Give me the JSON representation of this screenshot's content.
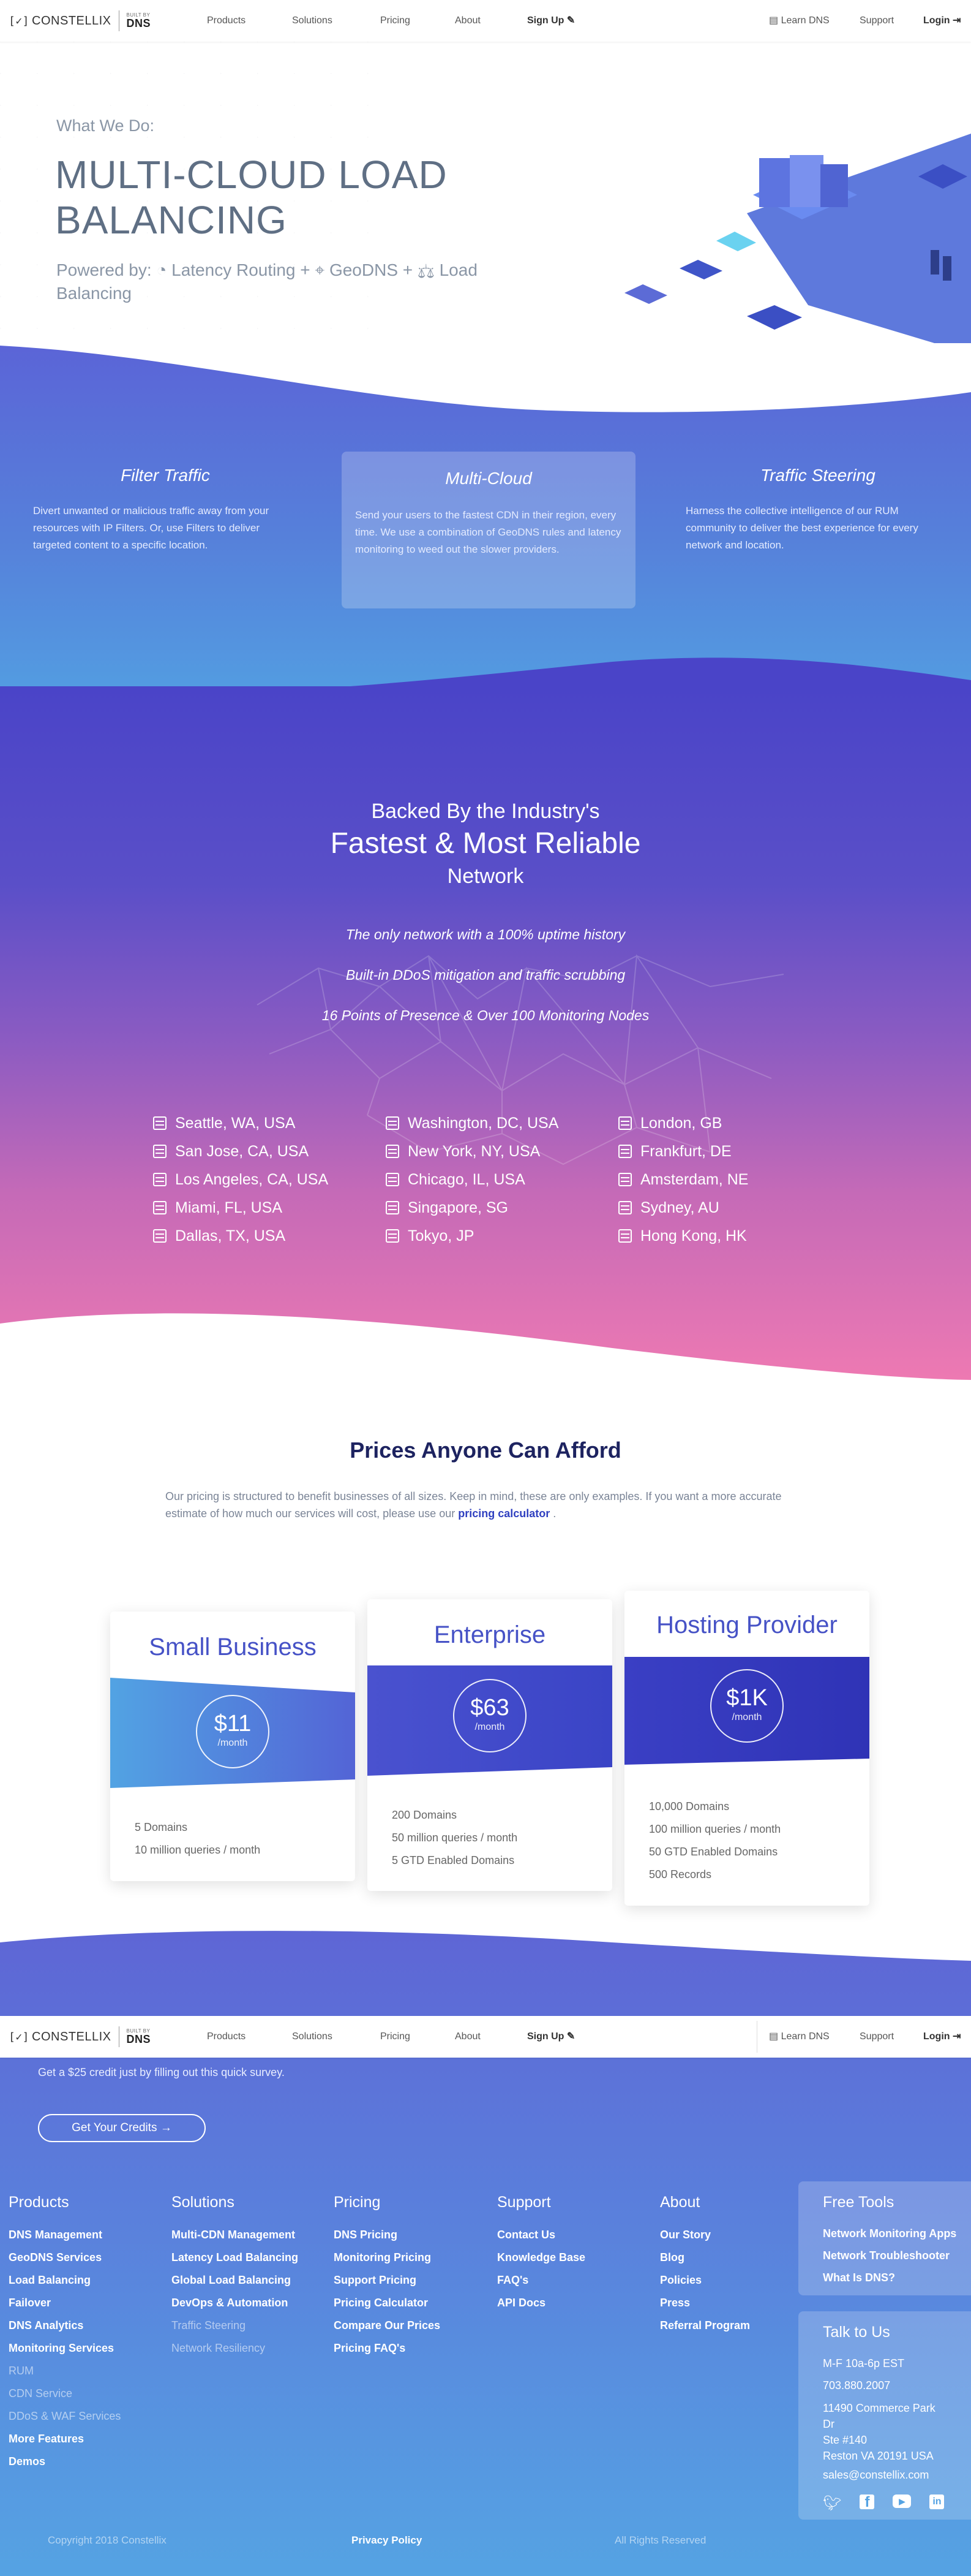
{
  "nav": {
    "brand": "CONSTELLIX",
    "brand_sub": "BUILT BY",
    "brand_dns": "DNS",
    "items": [
      "Products",
      "Solutions",
      "Pricing",
      "About"
    ],
    "signup": "Sign Up",
    "learn_dns": "Learn DNS",
    "support": "Support",
    "login": "Login"
  },
  "hero": {
    "eyebrow": "What We Do:",
    "title_line1": "MULTI-CLOUD LOAD",
    "title_line2": "BALANCING",
    "powered_by": "Powered by:",
    "tech1": "Latency Routing +",
    "tech2": "GeoDNS +",
    "tech3": "Load",
    "tech3b": "Balancing"
  },
  "features": [
    {
      "title": "Filter Traffic",
      "text": "Divert unwanted or malicious traffic away from your resources with IP Filters. Or, use Filters to deliver targeted content to a specific location."
    },
    {
      "title": "Multi-Cloud",
      "text": "Send your users to the fastest CDN in their region, every time. We use a combination of GeoDNS rules and latency monitoring to weed out the slower providers."
    },
    {
      "title": "Traffic Steering",
      "text": "Harness the collective intelligence of our RUM community to deliver the best experience for every network and location."
    }
  ],
  "network": {
    "line1": "Backed By the Industry's",
    "line2": "Fastest & Most Reliable",
    "line3": "Network",
    "claims": [
      "The only network with a 100% uptime history",
      "Built-in DDoS mitigation and traffic scrubbing",
      "16 Points of Presence & Over 100 Monitoring Nodes"
    ],
    "cities_col1": [
      "Seattle, WA, USA",
      "San Jose, CA, USA",
      "Los Angeles, CA, USA",
      "Miami, FL, USA",
      "Dallas, TX, USA"
    ],
    "cities_col2": [
      "Washington, DC, USA",
      "New York, NY, USA",
      "Chicago, IL, USA",
      "Singapore, SG",
      "Tokyo, JP"
    ],
    "cities_col3": [
      "London, GB",
      "Frankfurt, DE",
      "Amsterdam, NE",
      "Sydney, AU",
      "Hong Kong, HK"
    ]
  },
  "pricing": {
    "title": "Prices Anyone Can Afford",
    "intro": "Our pricing is structured to benefit businesses of all sizes. Keep in mind, these are only examples. If you want a more accurate estimate of how much our services will cost, please use our",
    "link": "pricing calculator",
    "period": ".",
    "plans": [
      {
        "name": "Small Business",
        "price": "$11",
        "per": "/month",
        "features": [
          "5 Domains",
          "10 million queries / month"
        ]
      },
      {
        "name": "Enterprise",
        "price": "$63",
        "per": "/month",
        "features": [
          "200 Domains",
          "50 million queries / month",
          "5 GTD Enabled Domains"
        ]
      },
      {
        "name": "Hosting Provider",
        "price": "$1K",
        "per": "/month",
        "features": [
          "10,000 Domains",
          "100 million queries / month",
          "50 GTD Enabled Domains",
          "500 Records"
        ]
      }
    ]
  },
  "survey": {
    "text": "Get a $25 credit just by filling out this quick survey.",
    "button": "Get Your Credits"
  },
  "footer": {
    "products": {
      "title": "Products",
      "items": [
        "DNS Management",
        "GeoDNS Services",
        "Load Balancing",
        "Failover",
        "DNS Analytics",
        "Monitoring Services",
        "RUM",
        "CDN Service",
        "DDoS & WAF Services",
        "More Features",
        "Demos"
      ]
    },
    "solutions": {
      "title": "Solutions",
      "items": [
        "Multi-CDN Management",
        "Latency Load Balancing",
        "Global Load Balancing",
        "DevOps & Automation",
        "Traffic Steering",
        "Network Resiliency"
      ]
    },
    "pricing": {
      "title": "Pricing",
      "items": [
        "DNS Pricing",
        "Monitoring Pricing",
        "Support Pricing",
        "Pricing Calculator",
        "Compare Our Prices",
        "Pricing FAQ's"
      ]
    },
    "support": {
      "title": "Support",
      "items": [
        "Contact Us",
        "Knowledge Base",
        "FAQ's",
        "API Docs"
      ]
    },
    "about": {
      "title": "About",
      "items": [
        "Our Story",
        "Blog",
        "Policies",
        "Press",
        "Referral Program"
      ]
    },
    "tools": {
      "title": "Free Tools",
      "items": [
        "Network Monitoring Apps",
        "Network Troubleshooter",
        "What Is DNS?"
      ]
    },
    "talk": {
      "title": "Talk to Us",
      "hours": "M-F 10a-6p EST",
      "phone": "703.880.2007",
      "addr1": "11490 Commerce Park Dr",
      "addr2": "Ste #140",
      "addr3": "Reston VA 20191 USA",
      "email": "sales@constellix.com"
    },
    "copyright": "Copyright 2018 Constellix",
    "privacy": "Privacy Policy",
    "rights": "All Rights Reserved"
  },
  "colors": {
    "accent": "#4652c6",
    "pink": "#f07ab2",
    "blue": "#52a3e3",
    "text": "#5f6f84"
  }
}
